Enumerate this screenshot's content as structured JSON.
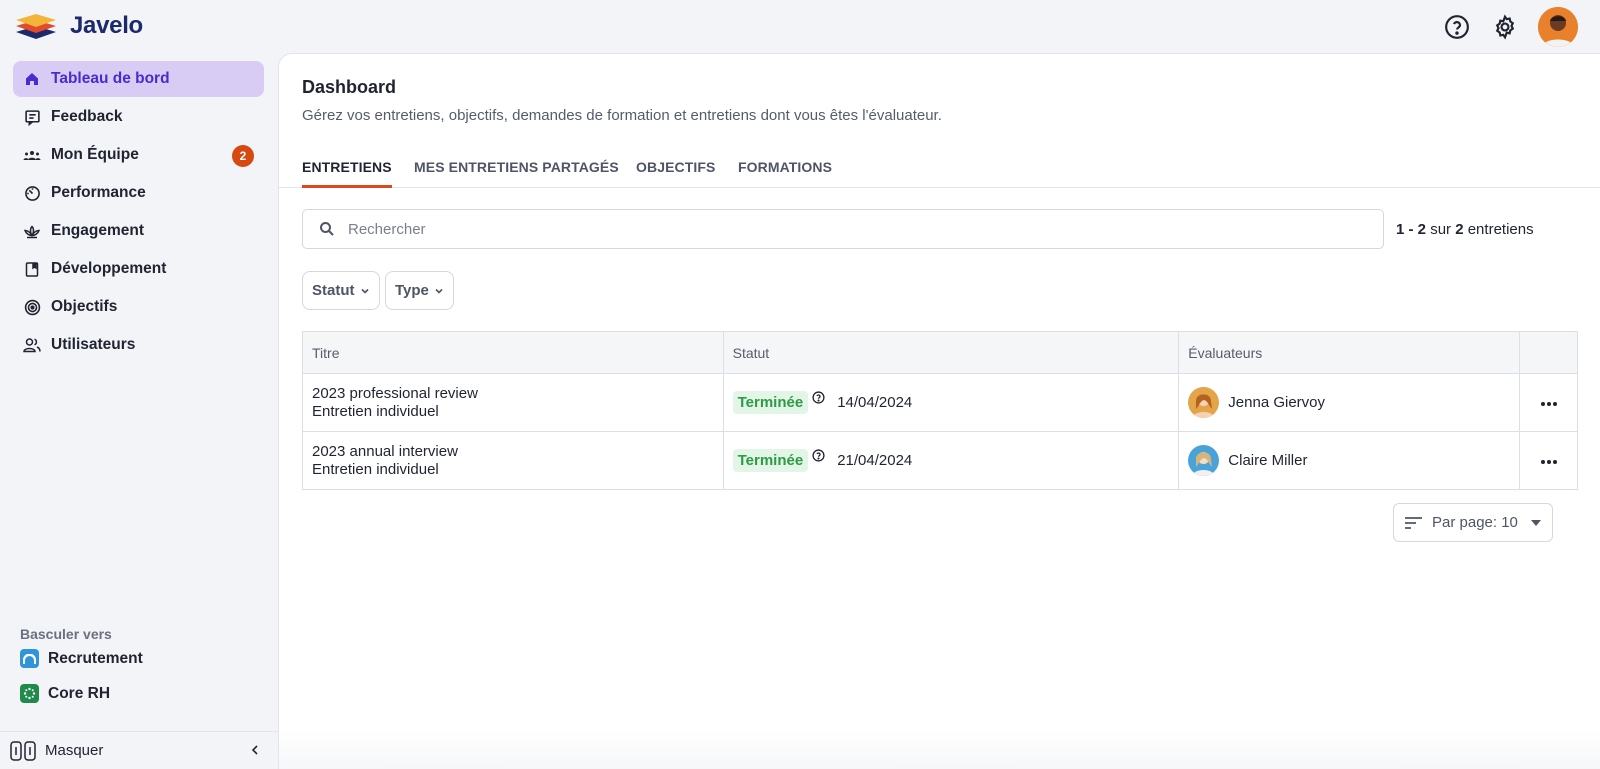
{
  "app": {
    "name": "Javelo"
  },
  "header": {
    "avatar_color": "#e9802b"
  },
  "sidebar": {
    "items": [
      {
        "label": "Tableau de bord",
        "icon": "home-icon",
        "active": true
      },
      {
        "label": "Feedback",
        "icon": "message-icon"
      },
      {
        "label": "Mon Équipe",
        "icon": "team-icon",
        "badge": "2"
      },
      {
        "label": "Performance",
        "icon": "gauge-icon"
      },
      {
        "label": "Engagement",
        "icon": "lotus-icon"
      },
      {
        "label": "Développement",
        "icon": "book-icon"
      },
      {
        "label": "Objectifs",
        "icon": "target-icon"
      },
      {
        "label": "Utilisateurs",
        "icon": "users-icon"
      }
    ],
    "switch_title": "Basculer vers",
    "switch_items": [
      {
        "label": "Recrutement",
        "icon": "recruitment-app-icon",
        "color": "#2f95d8"
      },
      {
        "label": "Core RH",
        "icon": "core-rh-app-icon",
        "color": "#1f8a4a"
      }
    ],
    "hide_label": "Masquer"
  },
  "main": {
    "title": "Dashboard",
    "subtitle": "Gérez vos entretiens, objectifs, demandes de formation et entretiens dont vous êtes l'évaluateur.",
    "tabs": [
      {
        "label": "ENTRETIENS",
        "active": true
      },
      {
        "label": "MES ENTRETIENS PARTAGÉS"
      },
      {
        "label": "OBJECTIFS"
      },
      {
        "label": "FORMATIONS"
      }
    ],
    "search": {
      "placeholder": "Rechercher",
      "value": ""
    },
    "count": {
      "range": "1 - 2",
      "word_sur": "sur",
      "total": "2",
      "unit": "entretiens"
    },
    "filters": [
      {
        "label": "Statut"
      },
      {
        "label": "Type"
      }
    ],
    "table": {
      "columns": [
        "Titre",
        "Statut",
        "Évaluateurs",
        ""
      ],
      "rows": [
        {
          "title": "2023 professional review",
          "type": "Entretien individuel",
          "status": "Terminée",
          "date": "14/04/2024",
          "evaluator": "Jenna Giervoy",
          "avatar_color": "#e3a44a"
        },
        {
          "title": "2023 annual interview",
          "type": "Entretien individuel",
          "status": "Terminée",
          "date": "21/04/2024",
          "evaluator": "Claire Miller",
          "avatar_color": "#4aa3d8"
        }
      ]
    },
    "per_page": {
      "label": "Par page: 10"
    }
  },
  "colors": {
    "accent": "#4b2bd1",
    "active_bg": "#d8ccf4",
    "tab_underline": "#d8491d",
    "status_green": "#2e9b45",
    "badge": "#d64a12"
  }
}
